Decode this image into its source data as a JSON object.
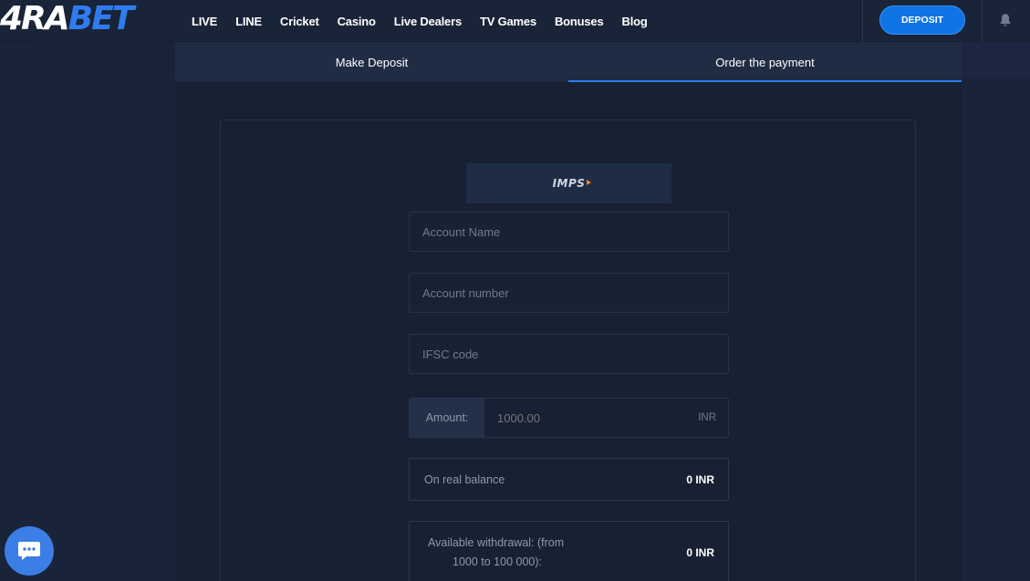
{
  "header": {
    "logo_prefix": "4RA",
    "logo_suffix": "BET",
    "nav": [
      "LIVE",
      "LINE",
      "Cricket",
      "Casino",
      "Live Dealers",
      "TV Games",
      "Bonuses",
      "Blog"
    ],
    "deposit_label": "DEPOSIT"
  },
  "tabs": {
    "make_deposit": "Make Deposit",
    "order_payment": "Order the payment"
  },
  "form": {
    "method_logo": "IMPS",
    "account_name_placeholder": "Account Name",
    "account_number_placeholder": "Account number",
    "ifsc_placeholder": "IFSC code",
    "amount_label": "Amount:",
    "amount_value": "1000.00",
    "amount_currency": "INR",
    "real_balance_label": "On real balance",
    "real_balance_value": "0 INR",
    "withdrawal_label_line1": "Available withdrawal: (from",
    "withdrawal_label_line2": "1000 to 100 000):",
    "withdrawal_value": "0 INR"
  },
  "colors": {
    "accent": "#2f7cf0",
    "background": "#19243a",
    "panel": "#172133"
  },
  "icons": {
    "bell": "bell-icon",
    "chat": "chat-icon"
  }
}
